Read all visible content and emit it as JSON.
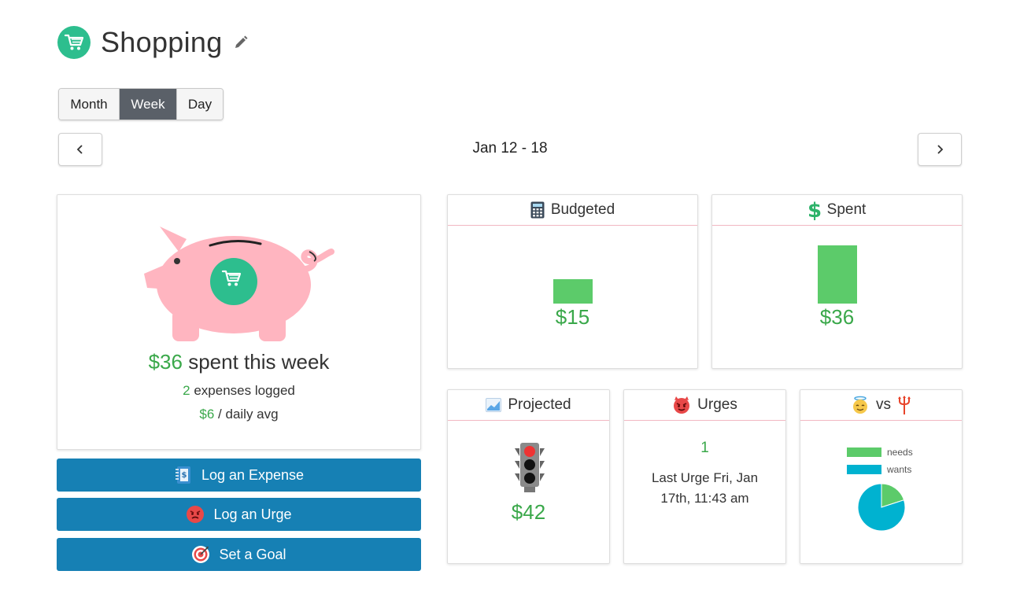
{
  "header": {
    "title": "Shopping",
    "category_icon": "shopping-cart-icon",
    "edit_icon": "pencil-icon"
  },
  "view_tabs": [
    {
      "label": "Month",
      "active": false
    },
    {
      "label": "Week",
      "active": true
    },
    {
      "label": "Day",
      "active": false
    }
  ],
  "date_nav": {
    "prev_icon": "chevron-left-icon",
    "next_icon": "chevron-right-icon",
    "range": "Jan 12 - 18"
  },
  "summary": {
    "illustration": "piggy-bank",
    "spent_amount": "$36",
    "spent_text": "spent this week",
    "expense_count": "2",
    "expense_text": "expenses logged",
    "daily_avg": "$6",
    "daily_avg_text": "/ daily avg"
  },
  "actions": [
    {
      "label": "Log an Expense",
      "icon": "ledger-icon"
    },
    {
      "label": "Log an Urge",
      "icon": "red-face-icon"
    },
    {
      "label": "Set a Goal",
      "icon": "target-icon"
    }
  ],
  "panels": {
    "budgeted": {
      "title": "Budgeted",
      "icon": "calculator-icon",
      "value": "$15",
      "amount": 15
    },
    "spent": {
      "title": "Spent",
      "icon": "dollar-sign-icon",
      "value": "$36",
      "amount": 36
    },
    "projected": {
      "title": "Projected",
      "icon": "chart-icon",
      "value": "$42",
      "status": "red"
    },
    "urges": {
      "title": "Urges",
      "icon": "devil-face-icon",
      "count": "1",
      "last": "Last Urge Fri, Jan 17th, 11:43 am"
    },
    "needs_wants": {
      "vs_label": "vs",
      "left_icon": "angel-face-icon",
      "right_icon": "trident-icon",
      "legend": [
        {
          "label": "needs",
          "color": "#5ccb6a"
        },
        {
          "label": "wants",
          "color": "#00b2d0"
        }
      ]
    }
  },
  "chart_data": {
    "type": "pie",
    "categories": [
      "needs",
      "wants"
    ],
    "values": [
      0.2,
      0.8
    ]
  },
  "colors": {
    "accent": "#1680b4",
    "green": "#3aa84a",
    "bar": "#5ccb6a",
    "teal": "#2dbe8e",
    "pink": "#ffb5c0"
  }
}
